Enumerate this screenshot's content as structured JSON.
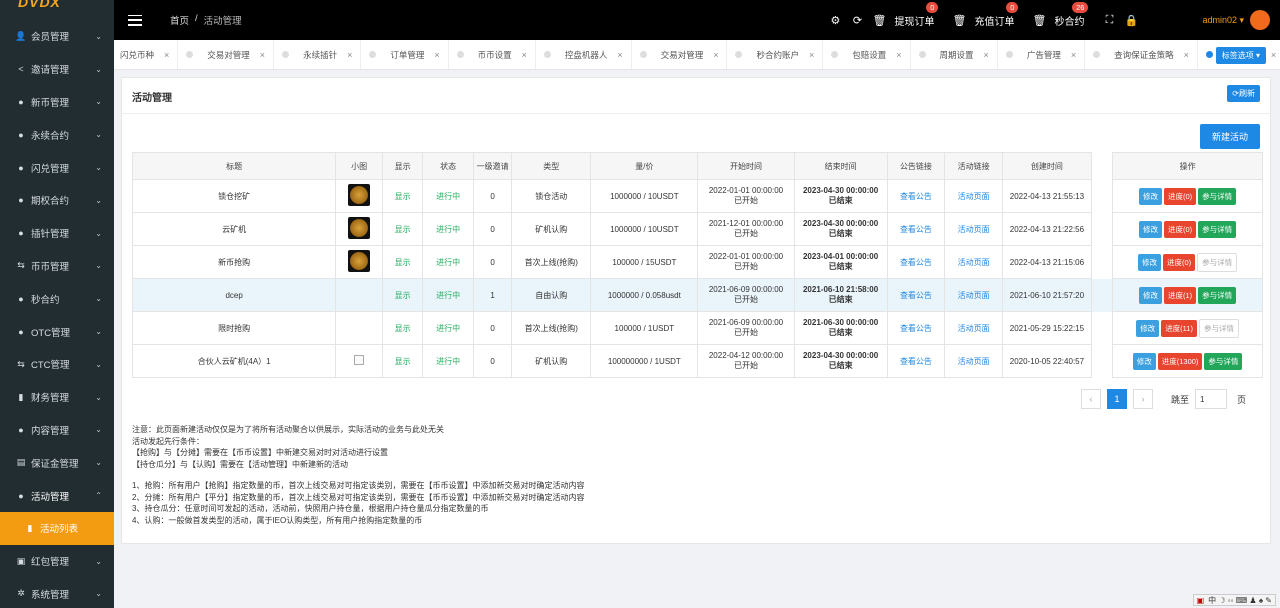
{
  "logo": "DVDX",
  "sidebar": {
    "items": [
      {
        "label": "会员管理",
        "icon": "user-icon"
      },
      {
        "label": "邀请管理",
        "icon": "share-icon"
      },
      {
        "label": "新币管理",
        "icon": "circle-icon"
      },
      {
        "label": "永续合约",
        "icon": "circle-icon"
      },
      {
        "label": "闪兑管理",
        "icon": "circle-icon"
      },
      {
        "label": "期权合约",
        "icon": "circle-icon"
      },
      {
        "label": "插针管理",
        "icon": "circle-icon"
      },
      {
        "label": "币币管理",
        "icon": "exchange-icon"
      },
      {
        "label": "秒合约",
        "icon": "circle-icon"
      },
      {
        "label": "OTC管理",
        "icon": "circle-icon"
      },
      {
        "label": "CTC管理",
        "icon": "exchange-icon"
      },
      {
        "label": "财务管理",
        "icon": "bar-chart-icon"
      },
      {
        "label": "内容管理",
        "icon": "circle-icon"
      },
      {
        "label": "保证金管理",
        "icon": "card-icon"
      },
      {
        "label": "活动管理",
        "icon": "circle-icon"
      }
    ],
    "active_sub": "活动列表",
    "bottom_items": [
      {
        "label": "红包管理",
        "icon": "gift-icon"
      },
      {
        "label": "系统管理",
        "icon": "gear-icon"
      }
    ]
  },
  "topbar": {
    "breadcrumb_home": "首页",
    "breadcrumb_sep": "/",
    "breadcrumb_current": "活动管理",
    "withdraw_label": "提现订单",
    "withdraw_badge": "0",
    "recharge_label": "充值订单",
    "recharge_badge": "0",
    "second_label": "秒合约",
    "second_badge": "26",
    "user": "admin02 ▾"
  },
  "tabs": {
    "items": [
      "闪兑币种",
      "交易对管理",
      "永续插针",
      "订单管理",
      "币币设置",
      "控盘机器人",
      "交易对管理",
      "秒合约账户",
      "包赔设置",
      "周期设置",
      "广告管理",
      "查询保证金策略",
      "活动列表"
    ],
    "options": "标签选项 ▾"
  },
  "panel": {
    "title": "活动管理",
    "refresh": "⟳刷新",
    "new_button": "新建活动",
    "columns": [
      "标题",
      "小图",
      "显示",
      "状态",
      "一级邀请",
      "类型",
      "量/价",
      "开始时间",
      "结束时间",
      "公告链接",
      "活动链接",
      "创建时间",
      "操作"
    ],
    "rows": [
      {
        "title": "锁仓挖矿",
        "img": "thumb",
        "show": "显示",
        "status": "进行中",
        "invite": "0",
        "type": "锁仓活动",
        "qty": "1000000 / 10USDT",
        "start": "2022-01-01 00:00:00",
        "start_s": "已开始",
        "end": "2023-04-30 00:00:00",
        "end_s": "已结束",
        "notice": "查看公告",
        "link": "活动页面",
        "created": "2022-04-13 21:55:13",
        "edit": "修改",
        "progress": "进度(0)",
        "detail": "参与详情",
        "detail_on": true
      },
      {
        "title": "云矿机",
        "img": "thumb",
        "show": "显示",
        "status": "进行中",
        "invite": "0",
        "type": "矿机认购",
        "qty": "1000000 / 10USDT",
        "start": "2021-12-01 00:00:00",
        "start_s": "已开始",
        "end": "2023-04-30 00:00:00",
        "end_s": "已结束",
        "notice": "查看公告",
        "link": "活动页面",
        "created": "2022-04-13 21:22:56",
        "edit": "修改",
        "progress": "进度(0)",
        "detail": "参与详情",
        "detail_on": true
      },
      {
        "title": "新币抢购",
        "img": "thumb",
        "show": "显示",
        "status": "进行中",
        "invite": "0",
        "type": "首次上线(抢购)",
        "qty": "100000 / 15USDT",
        "start": "2022-01-01 00:00:00",
        "start_s": "已开始",
        "end": "2023-04-01 00:00:00",
        "end_s": "已结束",
        "notice": "查看公告",
        "link": "活动页面",
        "created": "2022-04-13 21:15:06",
        "edit": "修改",
        "progress": "进度(0)",
        "detail": "参与详情",
        "detail_on": false
      },
      {
        "title": "dcep",
        "img": "",
        "show": "显示",
        "status": "进行中",
        "invite": "1",
        "type": "自由认购",
        "qty": "1000000 / 0.058usdt",
        "start": "2021-06-09 00:00:00",
        "start_s": "已开始",
        "end": "2021-06-10 21:58:00",
        "end_s": "已结束",
        "notice": "查看公告",
        "link": "活动页面",
        "created": "2021-06-10 21:57:20",
        "edit": "修改",
        "progress": "进度(1)",
        "detail": "参与详情",
        "detail_on": true
      },
      {
        "title": "限时抢购",
        "img": "",
        "show": "显示",
        "status": "进行中",
        "invite": "0",
        "type": "首次上线(抢购)",
        "qty": "100000 / 1USDT",
        "start": "2021-06-09 00:00:00",
        "start_s": "已开始",
        "end": "2021-06-30 00:00:00",
        "end_s": "已结束",
        "notice": "查看公告",
        "link": "活动页面",
        "created": "2021-05-29 15:22:15",
        "edit": "修改",
        "progress": "进度(11)",
        "detail": "参与详情",
        "detail_on": false
      },
      {
        "title": "合伙人云矿机(4A）1",
        "img": "broken",
        "show": "显示",
        "status": "进行中",
        "invite": "0",
        "type": "矿机认购",
        "qty": "100000000 / 1USDT",
        "start": "2022-04-12 00:00:00",
        "start_s": "已开始",
        "end": "2023-04-30 00:00:00",
        "end_s": "已结束",
        "notice": "查看公告",
        "link": "活动页面",
        "created": "2020-10-05 22:40:57",
        "edit": "修改",
        "progress": "进度(1300)",
        "detail": "参与详情",
        "detail_on": true
      }
    ],
    "pager": {
      "prev": "‹",
      "current": "1",
      "next": "›",
      "jump_label": "跳至",
      "jump_value": "1",
      "page_label": "页"
    },
    "notes": [
      "注意：此页面新建活动仅仅是为了将所有活动聚合以供展示，实际活动的业务与此处无关",
      "活动发起先行条件：",
      "【抢购】与【分摊】需要在【币币设置】中新建交易对时对活动进行设置",
      "【持仓瓜分】与【认购】需要在【活动管理】中新建新的活动",
      "",
      "1、抢购：所有用户【抢购】指定数量的币，首次上线交易对可指定该类别，需要在【币币设置】中添加新交易对时确定活动内容",
      "2、分摊：所有用户【平分】指定数量的币，首次上线交易对可指定该类别，需要在【币币设置】中添加新交易对时确定活动内容",
      "3、持仓瓜分：任意时间可发起的活动，活动前，快照用户持仓量，根据用户持仓量瓜分指定数量的币",
      "4、认购：一般做首发类型的活动，属于IEO认购类型，所有用户抢购指定数量的币"
    ]
  },
  "statusbar": "中 ☽ ◦◦ ⌨ ♟ ♠ ✎"
}
